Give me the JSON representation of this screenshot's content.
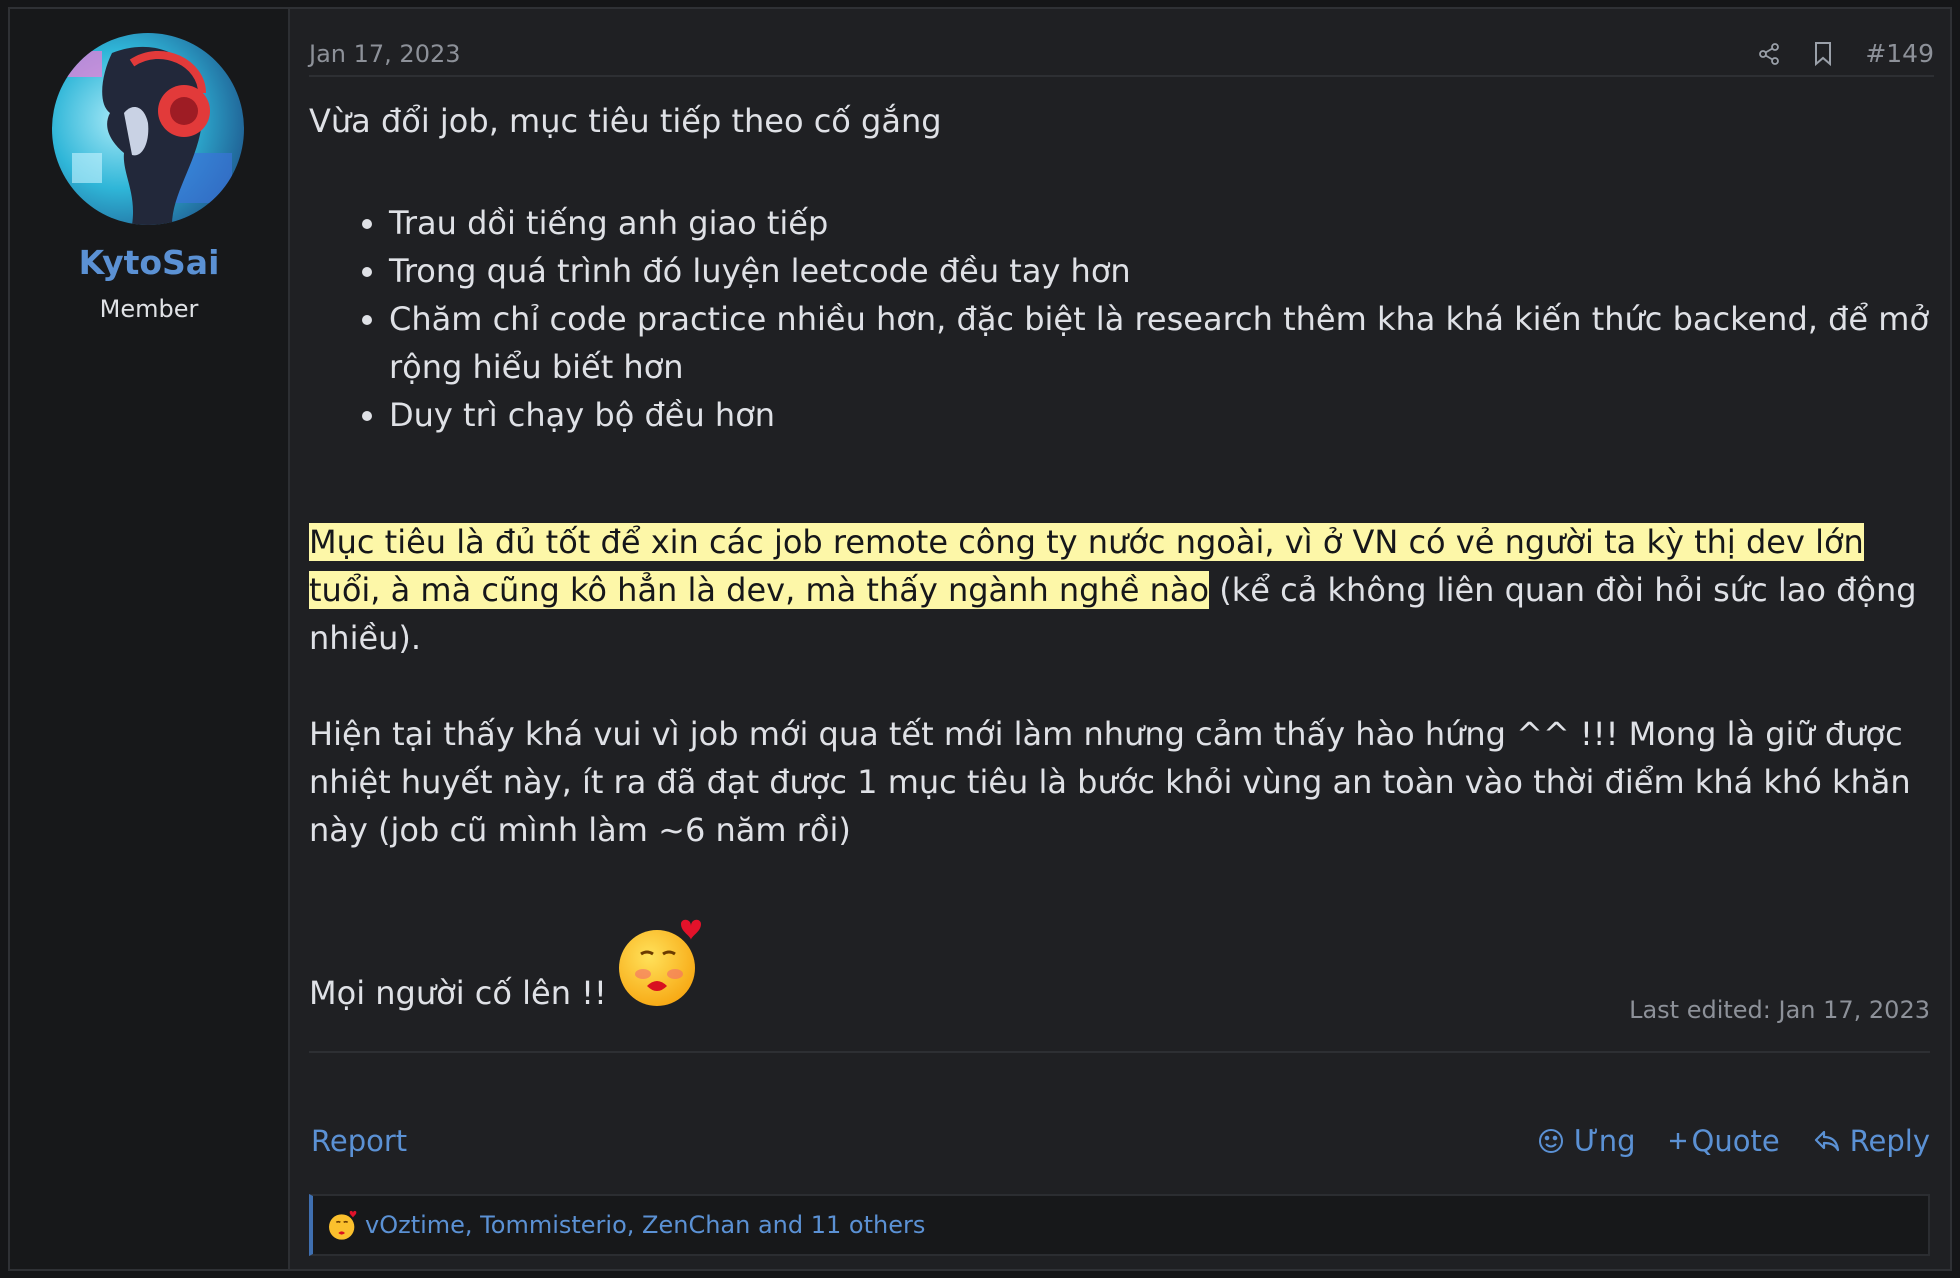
{
  "user": {
    "name": "KytoSai",
    "title": "Member"
  },
  "post": {
    "date": "Jan 17, 2023",
    "number": "#149",
    "intro": "Vừa đổi job, mục tiêu tiếp theo cố gắng",
    "goals": [
      "Trau dồi tiếng anh giao tiếp",
      "Trong quá trình đó luyện leetcode đều tay hơn",
      "Chăm chỉ code practice nhiều hơn, đặc biệt là research thêm kha khá kiến thức backend, để mở rộng hiểu biết hơn",
      "Duy trì chạy bộ đều hơn"
    ],
    "highlight": "Mục tiêu là đủ tốt để xin các job remote công ty nước ngoài, vì ở VN có vẻ người ta kỳ thị dev lớn tuổi, à mà cũng kô hẳn là dev, mà thấy ngành nghề nào",
    "highlight_rest": " (kể cả không liên quan đòi hỏi sức lao động nhiều).",
    "paragraph": "Hiện tại thấy khá vui vì job mới qua tết mới làm nhưng cảm thấy hào hứng ^^ !!! Mong là giữ được nhiệt huyết này, ít ra đã đạt được 1 mục tiêu là bước khỏi vùng an toàn vào thời điểm khá khó khăn này (job cũ mình làm ~6 năm rồi)",
    "closing": "Mọi người cố lên !!",
    "last_edited": "Last edited: Jan 17, 2023"
  },
  "footer": {
    "report": "Report",
    "react": "Ưng",
    "quote": "Quote",
    "reply": "Reply"
  },
  "reactions": {
    "text": "vOztime, Tommisterio, ZenChan and 11 others"
  },
  "colors": {
    "accent": "#5b91d4",
    "highlight": "#fdf7a8",
    "background": "#1f2023",
    "sidebar": "#17181a"
  },
  "icons": [
    "share-icon",
    "bookmark-icon",
    "react-smile-icon",
    "plus-icon",
    "reply-arrow-icon",
    "kiss-emoji-icon"
  ]
}
